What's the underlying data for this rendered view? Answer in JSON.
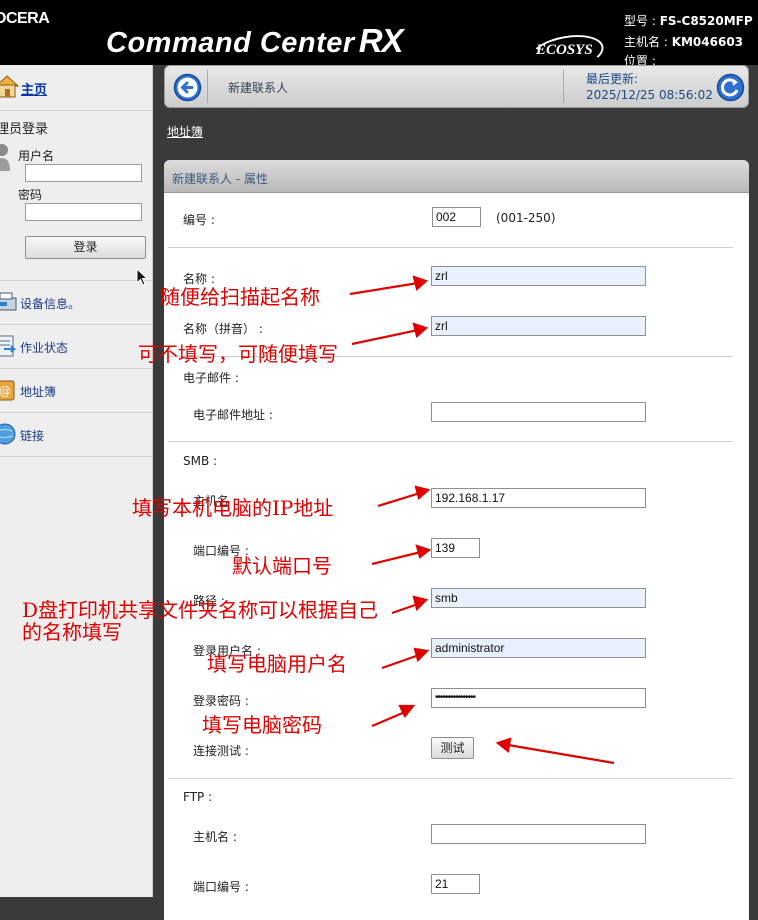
{
  "header": {
    "brand": "OCERA",
    "product": "Command Center",
    "product_suffix": "RX",
    "ecosys": "ECOSYS",
    "model_label": "型号 :",
    "model_value": "FS-C8520MFP",
    "host_label": "主机名 :",
    "host_value": "KM046603",
    "location_label": "位置 :"
  },
  "sidebar": {
    "home": "主页",
    "login_title": "理员登录",
    "username_label": "用户名",
    "password_label": "密码",
    "login_button": "登录",
    "items": [
      {
        "label": "设备信息。",
        "icon": "device-info-icon"
      },
      {
        "label": "作业状态",
        "icon": "job-status-icon"
      },
      {
        "label": "地址簿",
        "icon": "address-book-icon"
      },
      {
        "label": "链接",
        "icon": "link-globe-icon"
      }
    ]
  },
  "topbar": {
    "title": "新建联系人",
    "last_update_label": "最后更新:",
    "last_update_value": "2025/12/25 08:56:02"
  },
  "breadcrumb": "地址簿",
  "panel": {
    "title": "新建联系人 - 属性",
    "number_label": "编号 :",
    "number_value": "002",
    "number_range": "(001-250)",
    "name_label": "名称 :",
    "name_value": "zrl",
    "name_pinyin_label": "名称（拼音） :",
    "name_pinyin_value": "zrl",
    "email_section": "电子邮件 :",
    "email_label": "电子邮件地址 :",
    "email_value": "",
    "smb_section": "SMB :",
    "smb_host_label": "主机名 :",
    "smb_host_value": "192.168.1.17",
    "smb_port_label": "端口编号 :",
    "smb_port_value": "139",
    "smb_path_label": "路径 :",
    "smb_path_value": "smb",
    "smb_user_label": "登录用户名 :",
    "smb_user_value": "administrator",
    "smb_pass_label": "登录密码 :",
    "smb_pass_value": "••••••••••••••••",
    "smb_test_label": "连接测试 :",
    "smb_test_button": "测试",
    "ftp_section": "FTP :",
    "ftp_host_label": "主机名 :",
    "ftp_host_value": "",
    "ftp_port_label": "端口编号 :",
    "ftp_port_value": "21"
  },
  "annotations": {
    "name_note": "随便给扫描起名称",
    "pinyin_note": "可不填写，可随便填写",
    "host_note": "填写本机电脑的IP地址",
    "port_note": "默认端口号",
    "path_note_1": "D盘打印机共享文件夹名称可以根据自己",
    "path_note_2": "的名称填写",
    "user_note": "填写电脑用户名",
    "pass_note": "填写电脑密码",
    "color": "#e00000"
  }
}
